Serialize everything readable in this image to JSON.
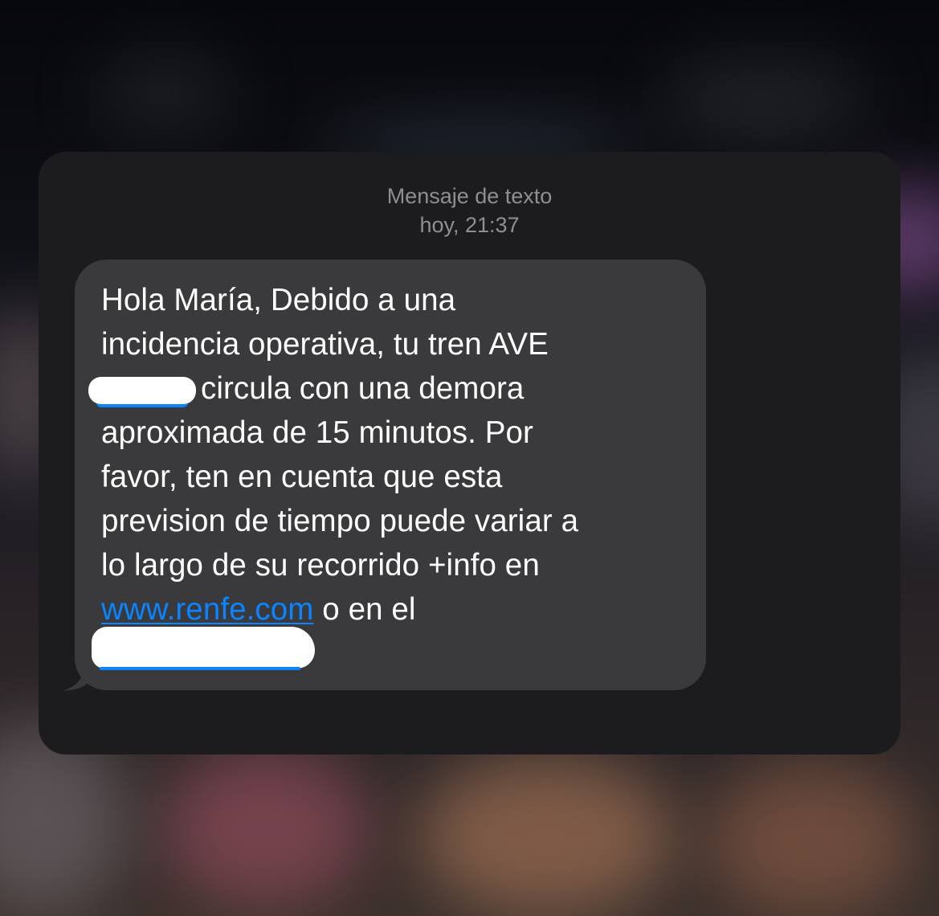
{
  "header": {
    "type_label": "Mensaje de texto",
    "timestamp": "hoy, 21:37"
  },
  "message": {
    "line1": "Hola María, Debido a una",
    "line2": "incidencia operativa, tu tren AVE",
    "line3_after_redaction": "circula con una demora",
    "line4": "aproximada de 15 minutos. Por",
    "line5": "favor, ten en cuenta que esta",
    "line6": "prevision de tiempo puede variar a",
    "line7": "lo largo de su recorrido  +info en",
    "link": "www.renfe.com",
    "line8_after_link": " o en el"
  },
  "colors": {
    "card_background": "#1c1c1e",
    "bubble_background": "#3a3a3c",
    "link": "#0a84ff",
    "text": "#ffffff",
    "header_text": "#8e8e93"
  }
}
